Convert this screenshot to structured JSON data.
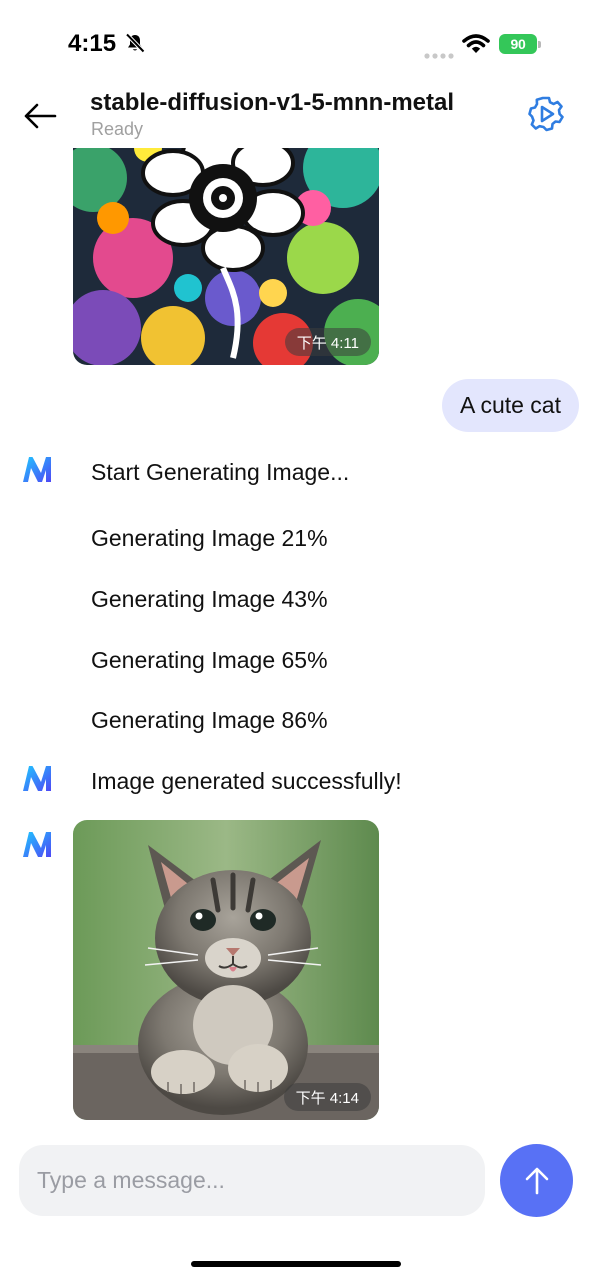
{
  "status_bar": {
    "time": "4:15",
    "battery": "90"
  },
  "header": {
    "title": "stable-diffusion-v1-5-mnn-metal",
    "status": "Ready"
  },
  "messages": {
    "image_1_time": "下午 4:11",
    "user_prompt": "A cute cat",
    "progress": [
      "Start Generating Image...",
      "Generating Image 21%",
      "Generating Image 43%",
      "Generating Image 65%",
      "Generating Image 86%"
    ],
    "success": "Image generated successfully!",
    "image_2_time": "下午 4:14"
  },
  "input": {
    "placeholder": "Type a message..."
  },
  "colors": {
    "accent": "#5871f5",
    "user_bubble": "#e3e6fd",
    "settings_icon": "#2f7de1",
    "battery": "#34c759"
  }
}
